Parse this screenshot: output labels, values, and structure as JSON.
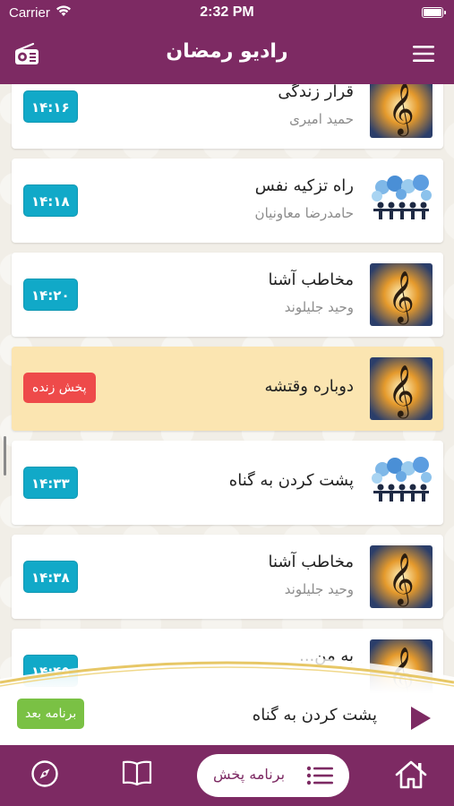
{
  "status_bar": {
    "carrier": "Carrier",
    "time": "2:32 PM"
  },
  "header": {
    "title": "رادیو رمضان",
    "left_icon": "radio-icon",
    "right_icon": "hamburger-menu-icon",
    "background_color": "#7d2a63"
  },
  "programs": [
    {
      "title": "قرار زندگی",
      "subtitle": "حمید امیری",
      "time": "۱۴:۱۶",
      "thumb": "music-clef"
    },
    {
      "title": "راه تزکیه نفس",
      "subtitle": "حامدرضا معاونیان",
      "time": "۱۴:۱۸",
      "thumb": "conference"
    },
    {
      "title": "مخاطب آشنا",
      "subtitle": "وحید جلیلوند",
      "time": "۱۴:۲۰",
      "thumb": "music-clef"
    },
    {
      "title": "دوباره وقتشه",
      "subtitle": "",
      "time": "",
      "live_label": "پخش زنده",
      "thumb": "music-clef"
    },
    {
      "title": "پشت کردن به گناه",
      "subtitle": "",
      "time": "۱۴:۳۳",
      "thumb": "conference"
    },
    {
      "title": "مخاطب آشنا",
      "subtitle": "وحید جلیلوند",
      "time": "۱۴:۳۸",
      "thumb": "music-clef"
    },
    {
      "title": "به من...",
      "subtitle": "",
      "time": "۱۴:۴۵",
      "thumb": "music-clef"
    }
  ],
  "now_playing": {
    "title": "پشت کردن به گناه",
    "next_label": "برنامه بعد"
  },
  "tab_bar": {
    "schedule_label": "برنامه پخش",
    "tabs": [
      "home-icon",
      "schedule-list-icon",
      "book-icon",
      "compass-icon"
    ]
  },
  "colors": {
    "primary": "#7d2a63",
    "time_badge": "#11a9c8",
    "live_badge": "#ee4a4a",
    "live_row": "#fbe5b1",
    "next_button": "#7ac144"
  }
}
